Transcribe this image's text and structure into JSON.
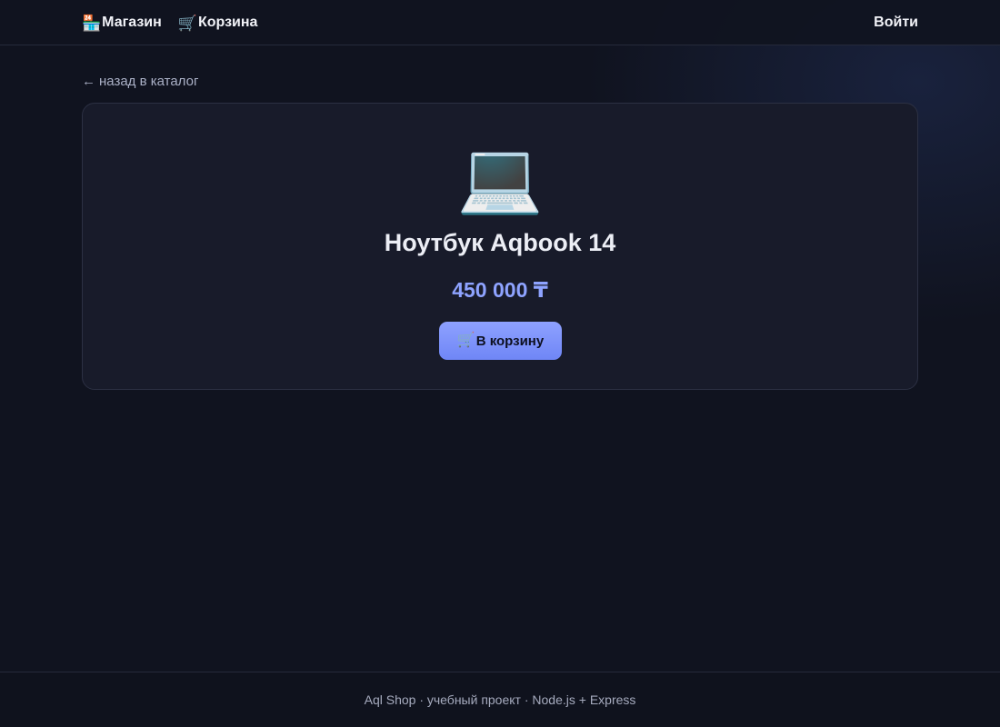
{
  "header": {
    "shop": {
      "icon": "🏪",
      "icon_name": "shop-icon",
      "label": "Магазин"
    },
    "cart": {
      "icon": "🛒",
      "icon_name": "cart-icon",
      "label": "Корзина"
    },
    "login_label": "Войти"
  },
  "back_link": {
    "arrow": "←",
    "label": "назад в каталог"
  },
  "product": {
    "emoji": "💻",
    "emoji_name": "laptop-icon",
    "title": "Ноутбук Aqbook 14",
    "price": "450 000 ₸",
    "add_to_cart": {
      "icon": "🛒",
      "label": "В корзину"
    }
  },
  "footer": {
    "text": "Aql Shop · учебный проект · Node.js + Express"
  },
  "colors": {
    "background": "#10131f",
    "card": "#181b2a",
    "accent": "#8ea3ff",
    "button": "#7d93fb"
  }
}
